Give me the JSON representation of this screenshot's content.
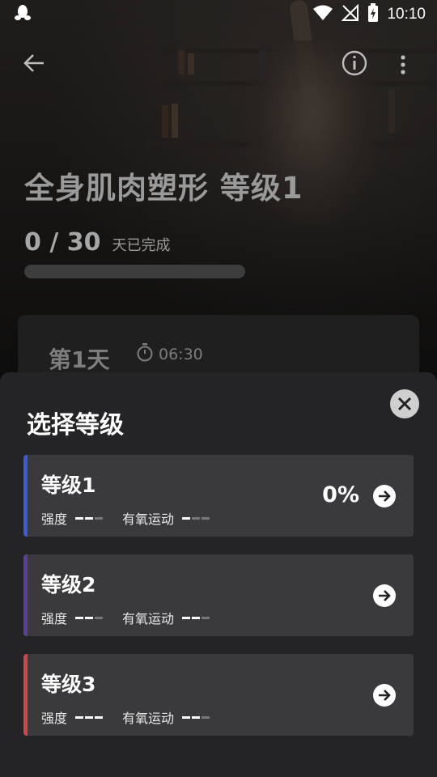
{
  "status_bar": {
    "time": "10:10"
  },
  "header": {
    "title": "全身肌肉塑形 等级1"
  },
  "progress": {
    "days": "0 / 30",
    "days_label": "天已完成",
    "fraction": 0
  },
  "day_card": {
    "label": "第1天",
    "duration": "06:30"
  },
  "sheet": {
    "title": "选择等级",
    "levels": [
      {
        "name": "等级1",
        "percent": "0%",
        "stripe_color": "#3a5bd9",
        "intensity_label": "强度",
        "intensity_level": 2,
        "intensity_max": 3,
        "cardio_label": "有氧运动",
        "cardio_level": 1,
        "cardio_max": 3
      },
      {
        "name": "等级2",
        "percent": "",
        "stripe_color": "#5a3e9a",
        "intensity_label": "强度",
        "intensity_level": 2,
        "intensity_max": 3,
        "cardio_label": "有氧运动",
        "cardio_level": 2,
        "cardio_max": 3
      },
      {
        "name": "等级3",
        "percent": "",
        "stripe_color": "#d34545",
        "intensity_label": "强度",
        "intensity_level": 3,
        "intensity_max": 3,
        "cardio_label": "有氧运动",
        "cardio_level": 2,
        "cardio_max": 3
      }
    ]
  },
  "colors": {
    "sheet_bg": "#242426",
    "card_bg": "#3a3a3d",
    "accent_blue": "#3a5bd9"
  }
}
